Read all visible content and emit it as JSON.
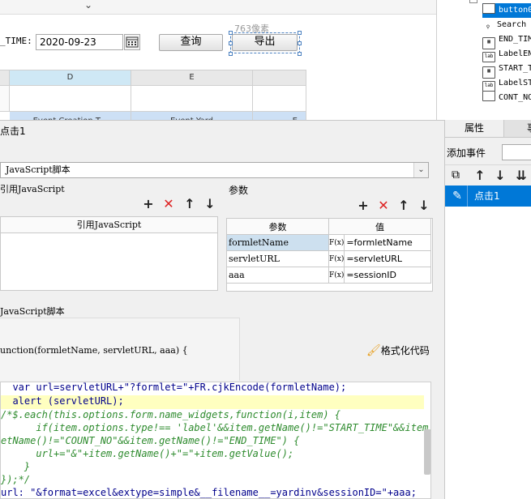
{
  "designer": {
    "date_label": "_TIME:",
    "date_value": "2020-09-23",
    "query_button": "查询",
    "export_button": "导出",
    "size_hint": "763像素",
    "column_headers": [
      "D",
      "E"
    ],
    "row_texts": [
      "Event Creation T...",
      "Event Yard",
      "E"
    ]
  },
  "tree": {
    "items": [
      "button0",
      "Search",
      "END_TIM",
      "LabelEN",
      "START_T",
      "LabelST",
      "CONT_NO"
    ],
    "item_icons": [
      "button-icon",
      "search-icon",
      "datefield-icon",
      "label-icon",
      "datefield-icon",
      "label-icon",
      "textfield-icon"
    ]
  },
  "dialog": {
    "title": "点击1",
    "type_select": "JavaScript脚本",
    "ref_js_label": "引用JavaScript",
    "ref_js_column": "引用JavaScript",
    "params_label": "参数",
    "params_columns": [
      "参数",
      "值"
    ],
    "params": [
      {
        "name": "formletName",
        "fx": "F(x)",
        "value": "=formletName"
      },
      {
        "name": "servletURL",
        "fx": "F(x)",
        "value": "=servletURL"
      },
      {
        "name": "aaa",
        "fx": "F(x)",
        "value": "=sessionID"
      }
    ],
    "js_section_label": "JavaScript脚本",
    "function_signature": "unction(formletName, servletURL, aaa) {",
    "format_code_button": "格式化代码"
  },
  "code": {
    "lines": [
      "  var url=servletURL+\"?formlet=\"+FR.cjkEncode(formletName);",
      "  alert (servletURL);",
      "/*$.each(this.options.form.name_widgets,function(i,item) {",
      "      if(item.options.type!== 'label'&&item.getName()!=\"START_TIME\"&&item.g",
      "etName()!=\"COUNT_NO\"&&item.getName()!=\"END_TIME\") {",
      "      url+=\"&\"+item.getName()+\"=\"+item.getValue();",
      "    }",
      "});*/",
      "url: \"&format=excel&extype=simple&__filename__=yardinv&sessionID=\"+aaa;"
    ]
  },
  "props": {
    "tabs": [
      "属性",
      "事"
    ],
    "add_event_label": "添加事件",
    "events": [
      "点击1"
    ]
  },
  "colors": {
    "highlight_line": "#ffffc0",
    "selected_event": "#0078d7",
    "selected_param": "#cde0ef",
    "grid_header": "#cfe8f5",
    "grid_row": "#cde0f5"
  }
}
